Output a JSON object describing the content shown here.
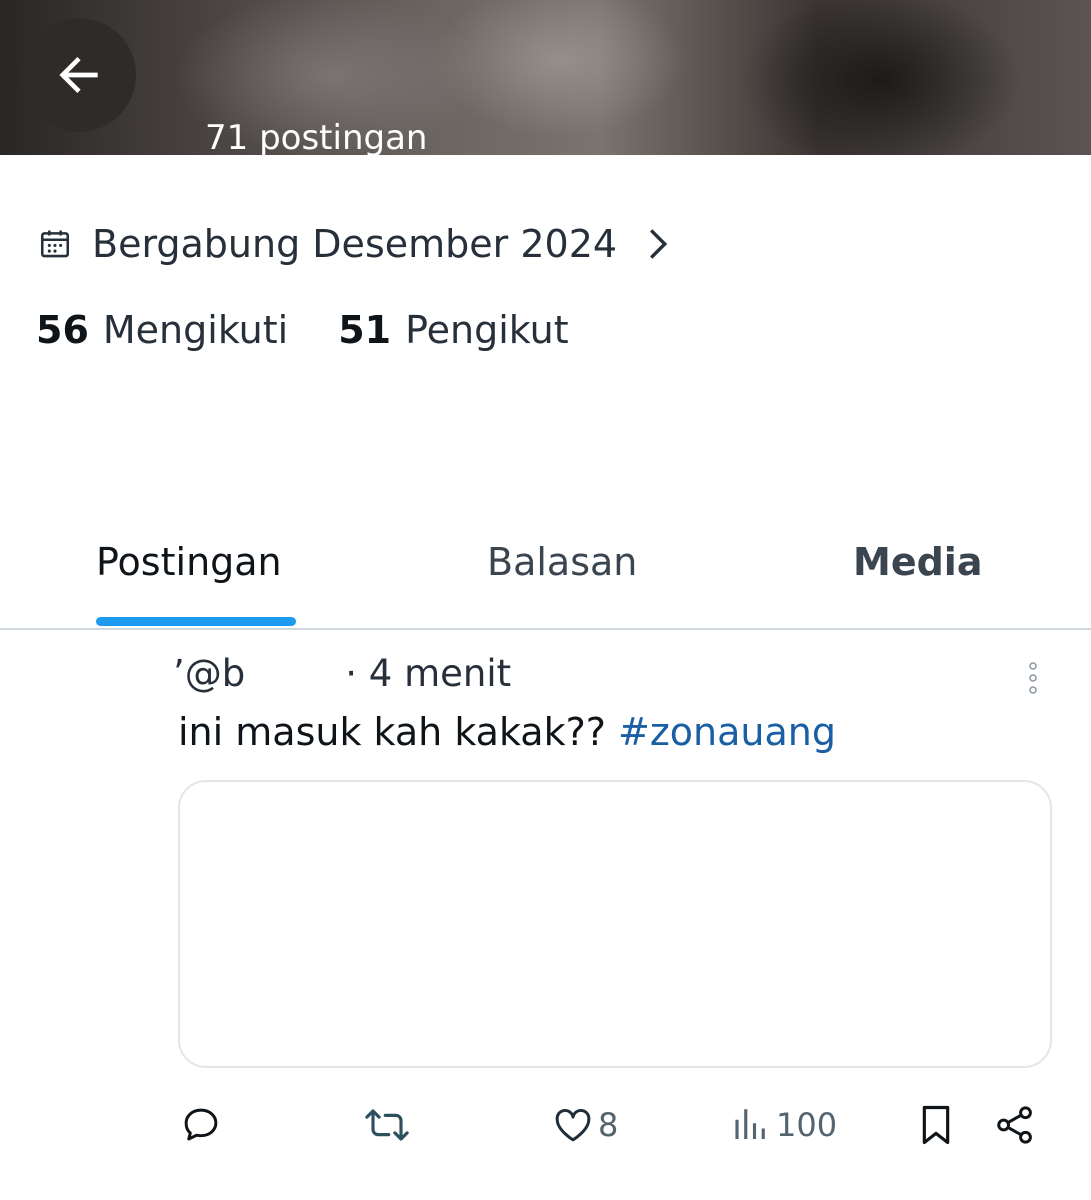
{
  "header": {
    "posts_count": "71 postingan"
  },
  "profile": {
    "joined": "Bergabung Desember 2024",
    "following_count": "56",
    "following_label": "Mengikuti",
    "followers_count": "51",
    "followers_label": "Pengikut"
  },
  "tabs": [
    {
      "label": "Postingan",
      "active": true
    },
    {
      "label": "Balasan",
      "active": false
    },
    {
      "label": "Media",
      "active": false
    }
  ],
  "tweet": {
    "handle": "ʼ@b",
    "time": "· 4 menit",
    "text": "ini masuk kah kakak?? ",
    "hashtag": "#zonauang",
    "likes": "8",
    "views": "100"
  },
  "colors": {
    "accent": "#1d9bf0",
    "hashtag": "#1a5fa3",
    "icon": "#536471"
  },
  "icons": [
    "back-arrow-icon",
    "calendar-icon",
    "chevron-right-icon",
    "more-vertical-icon",
    "reply-icon",
    "retweet-icon",
    "heart-icon",
    "views-icon",
    "bookmark-icon",
    "share-icon"
  ]
}
